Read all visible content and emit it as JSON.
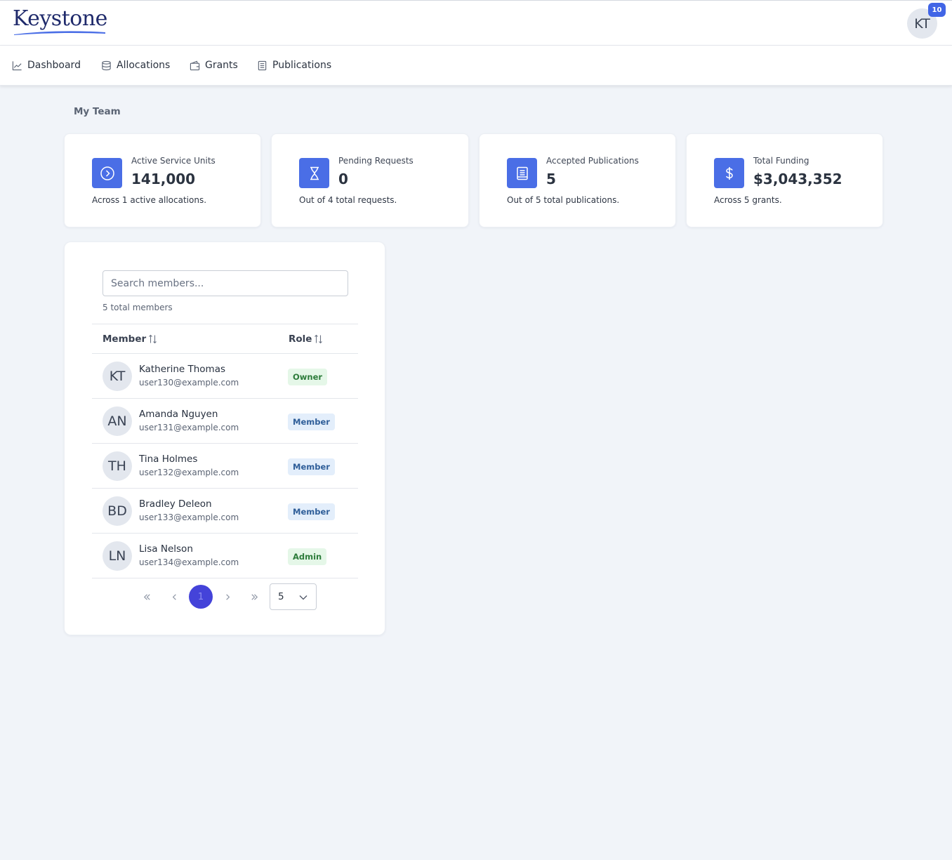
{
  "app": {
    "logo_text": "Keystone",
    "user_initials": "KT",
    "notification_count": "10"
  },
  "nav": {
    "items": [
      {
        "label": "Dashboard",
        "icon": "chart-line-icon"
      },
      {
        "label": "Allocations",
        "icon": "database-icon"
      },
      {
        "label": "Grants",
        "icon": "wallet-icon"
      },
      {
        "label": "Publications",
        "icon": "document-icon"
      }
    ]
  },
  "page": {
    "section_title": "My Team"
  },
  "stats": [
    {
      "label": "Active Service Units",
      "value": "141,000",
      "sub": "Across 1 active allocations.",
      "icon": "chevron-circle-right-icon"
    },
    {
      "label": "Pending Requests",
      "value": "0",
      "sub": "Out of 4 total requests.",
      "icon": "hourglass-icon"
    },
    {
      "label": "Accepted Publications",
      "value": "5",
      "sub": "Out of 5 total publications.",
      "icon": "book-icon"
    },
    {
      "label": "Total Funding",
      "value": "$3,043,352",
      "sub": "Across 5 grants.",
      "icon": "dollar-icon"
    }
  ],
  "members": {
    "search_placeholder": "Search members...",
    "total_label": "5 total members",
    "columns": {
      "member": "Member",
      "role": "Role"
    },
    "rows": [
      {
        "initials": "KT",
        "name": "Katherine Thomas",
        "email": "user130@example.com",
        "role": "Owner",
        "role_style": "green"
      },
      {
        "initials": "AN",
        "name": "Amanda Nguyen",
        "email": "user131@example.com",
        "role": "Member",
        "role_style": "blue"
      },
      {
        "initials": "TH",
        "name": "Tina Holmes",
        "email": "user132@example.com",
        "role": "Member",
        "role_style": "blue"
      },
      {
        "initials": "BD",
        "name": "Bradley Deleon",
        "email": "user133@example.com",
        "role": "Member",
        "role_style": "blue"
      },
      {
        "initials": "LN",
        "name": "Lisa Nelson",
        "email": "user134@example.com",
        "role": "Admin",
        "role_style": "green"
      }
    ],
    "pagination": {
      "current_page": "1",
      "page_size": "5"
    }
  },
  "colors": {
    "accent": "#4a6ee6",
    "page_bg": "#f1f4f9",
    "pager_current": "#4443d9",
    "badge_green": "#2d7c3b",
    "badge_blue": "#2f5e99"
  }
}
